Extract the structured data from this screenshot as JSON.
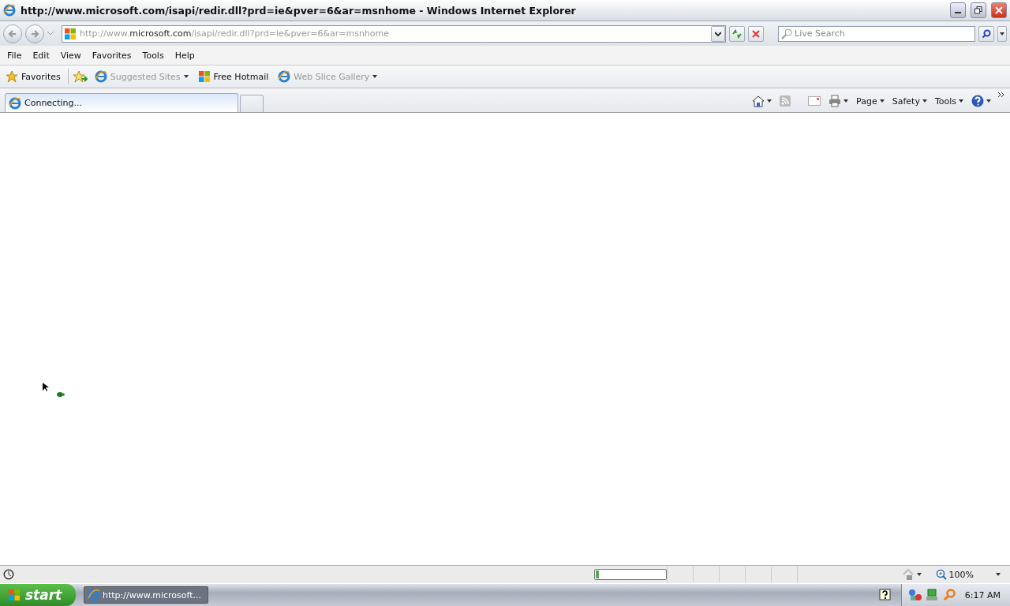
{
  "window": {
    "title": "http://www.microsoft.com/isapi/redir.dll?prd=ie&pver=6&ar=msnhome - Windows Internet Explorer"
  },
  "address": {
    "prefix": "http://www.",
    "domain": "microsoft.com",
    "path": "/isapi/redir.dll?prd=ie&pver=6&ar=msnhome"
  },
  "search": {
    "placeholder": "Live Search"
  },
  "menu": [
    "File",
    "Edit",
    "View",
    "Favorites",
    "Tools",
    "Help"
  ],
  "favorites_bar": {
    "label": "Favorites",
    "items": [
      {
        "label": "Suggested Sites",
        "kind": "page",
        "disabled": true,
        "dropdown": true
      },
      {
        "label": "Free Hotmail",
        "kind": "windows",
        "disabled": false,
        "dropdown": false
      },
      {
        "label": "Web Slice Gallery",
        "kind": "page",
        "disabled": true,
        "dropdown": true
      }
    ]
  },
  "tabs": [
    {
      "label": "Connecting...",
      "selected": true
    }
  ],
  "command_bar": [
    "Page",
    "Safety",
    "Tools"
  ],
  "status_bar": {
    "level": 0.05,
    "zoom": "100%"
  },
  "taskbar": {
    "start": "start",
    "tasks": [
      {
        "label": "http://www.microsoft...",
        "selected": true
      }
    ],
    "clock": "6:17 AM"
  }
}
